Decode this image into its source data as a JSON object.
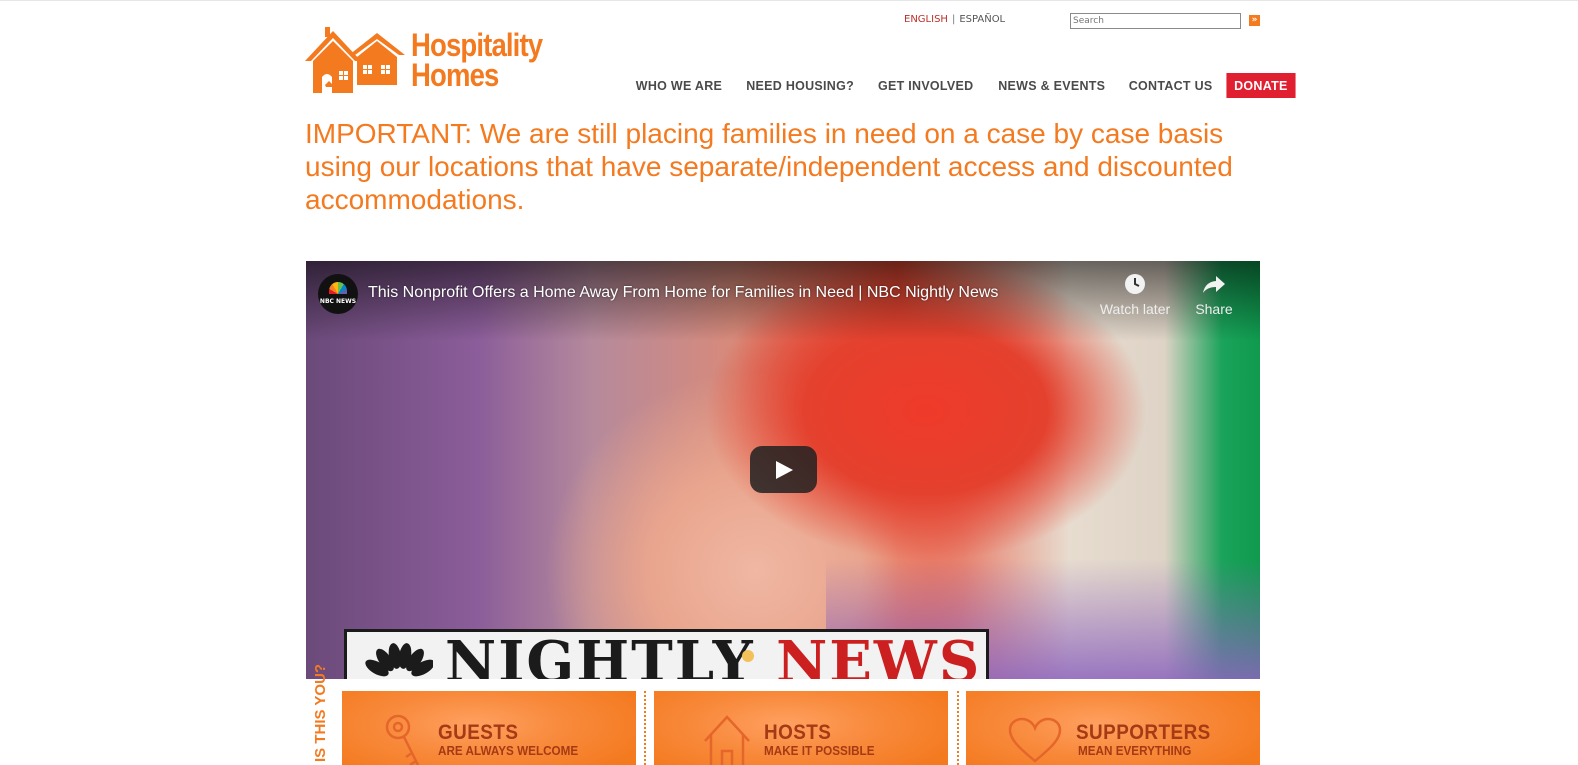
{
  "header": {
    "lang_english": "ENGLISH",
    "lang_separator": "|",
    "lang_spanish": "ESPAÑOL",
    "search_placeholder": "Search",
    "search_button": "»"
  },
  "logo": {
    "line1": "Hospitality",
    "line2": "Homes",
    "color": "#f47a20"
  },
  "nav": {
    "items": [
      "WHO WE ARE",
      "NEED HOUSING?",
      "GET INVOLVED",
      "NEWS & EVENTS",
      "CONTACT US"
    ],
    "donate": "DONATE",
    "donate_color": "#e01f30"
  },
  "notice": "IMPORTANT: We are still placing families in need on a case by case basis using our locations that have separate/independent access and discounted accommodations.",
  "video": {
    "channel": "NBC NEWS",
    "title": "This Nonprofit Offers a Home Away From Home for Families in Need | NBC Nightly News",
    "watch_later": "Watch later",
    "share": "Share",
    "banner_left": "NIGHTLY ",
    "banner_right": "NEWS"
  },
  "bottom": {
    "vertical_label": "IS THIS YOU?",
    "boxes": [
      {
        "title": "GUESTS",
        "subtitle": "ARE ALWAYS WELCOME",
        "icon": "key-icon"
      },
      {
        "title": "HOSTS",
        "subtitle": "MAKE IT POSSIBLE",
        "icon": "house-icon"
      },
      {
        "title": "SUPPORTERS",
        "subtitle": "MEAN EVERYTHING",
        "icon": "heart-icon"
      }
    ]
  }
}
